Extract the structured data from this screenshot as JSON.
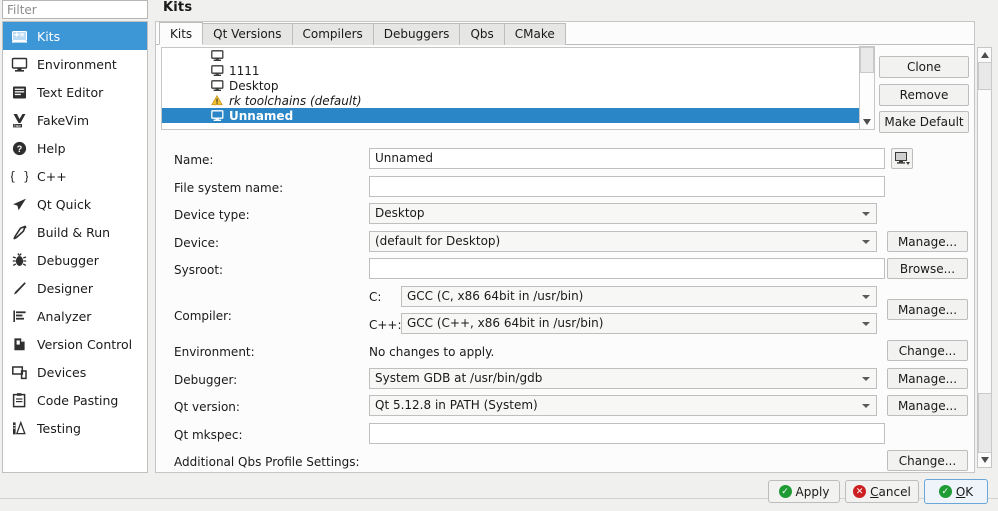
{
  "colors": {
    "accent": "#3d96d6",
    "list_selection": "#2b86c8",
    "apply_green": "#1f9b34",
    "cancel_red": "#cc2020",
    "warning_yellow": "#f2c12e"
  },
  "filter": {
    "placeholder": "Filter",
    "value": ""
  },
  "sidebar": {
    "items": [
      {
        "label": "Kits",
        "icon": "kits-icon",
        "selected": true
      },
      {
        "label": "Environment",
        "icon": "monitor-icon",
        "selected": false
      },
      {
        "label": "Text Editor",
        "icon": "text-editor-icon",
        "selected": false
      },
      {
        "label": "FakeVim",
        "icon": "fakevim-icon",
        "selected": false
      },
      {
        "label": "Help",
        "icon": "help-question-icon",
        "selected": false
      },
      {
        "label": "C++",
        "icon": "braces-icon",
        "selected": false
      },
      {
        "label": "Qt Quick",
        "icon": "paper-plane-icon",
        "selected": false
      },
      {
        "label": "Build & Run",
        "icon": "hammer-icon",
        "selected": false
      },
      {
        "label": "Debugger",
        "icon": "bug-icon",
        "selected": false
      },
      {
        "label": "Designer",
        "icon": "pencil-icon",
        "selected": false
      },
      {
        "label": "Analyzer",
        "icon": "analyzer-chart-icon",
        "selected": false
      },
      {
        "label": "Version Control",
        "icon": "version-control-icon",
        "selected": false
      },
      {
        "label": "Devices",
        "icon": "devices-icon",
        "selected": false
      },
      {
        "label": "Code Pasting",
        "icon": "clipboard-icon",
        "selected": false
      },
      {
        "label": "Testing",
        "icon": "testing-flask-icon",
        "selected": false
      }
    ]
  },
  "header": {
    "title": "Kits"
  },
  "tabs": [
    {
      "label": "Kits",
      "active": true
    },
    {
      "label": "Qt Versions",
      "active": false
    },
    {
      "label": "Compilers",
      "active": false
    },
    {
      "label": "Debuggers",
      "active": false
    },
    {
      "label": "Qbs",
      "active": false
    },
    {
      "label": "CMake",
      "active": false
    }
  ],
  "kit_list": {
    "rows": [
      {
        "label": "",
        "icon": "monitor-icon",
        "selected": false,
        "italic": false
      },
      {
        "label": "1111",
        "icon": "monitor-icon",
        "selected": false,
        "italic": false
      },
      {
        "label": "Desktop",
        "icon": "monitor-icon",
        "selected": false,
        "italic": false
      },
      {
        "label": "rk toolchains (default)",
        "icon": "warning-icon",
        "selected": false,
        "italic": true
      },
      {
        "label": "Unnamed",
        "icon": "monitor-icon",
        "selected": true,
        "italic": false
      }
    ]
  },
  "list_buttons": [
    {
      "label": "Clone"
    },
    {
      "label": "Remove"
    },
    {
      "label": "Make Default"
    }
  ],
  "form": {
    "name": {
      "label": "Name:",
      "value": "Unnamed",
      "button_icon": "monitor-dropdown-icon"
    },
    "file_system_name": {
      "label": "File system name:",
      "value": ""
    },
    "device_type": {
      "label": "Device type:",
      "value": "Desktop"
    },
    "device": {
      "label": "Device:",
      "value": "(default for Desktop)",
      "button": "Manage..."
    },
    "sysroot": {
      "label": "Sysroot:",
      "value": "",
      "button": "Browse..."
    },
    "compiler": {
      "label": "Compiler:",
      "c_label": "C:",
      "c_value": "GCC (C, x86 64bit in /usr/bin)",
      "cpp_label": "C++:",
      "cpp_value": "GCC (C++, x86 64bit in /usr/bin)",
      "button": "Manage..."
    },
    "environment": {
      "label": "Environment:",
      "value": "No changes to apply.",
      "button": "Change..."
    },
    "debugger": {
      "label": "Debugger:",
      "value": "System GDB at /usr/bin/gdb",
      "button": "Manage..."
    },
    "qt_version": {
      "label": "Qt version:",
      "value": "Qt 5.12.8 in PATH (System)",
      "button": "Manage..."
    },
    "qt_mkspec": {
      "label": "Qt mkspec:",
      "value": ""
    },
    "additional_qbs": {
      "label": "Additional Qbs Profile Settings:",
      "button": "Change..."
    }
  },
  "footer": {
    "apply": {
      "label": "Apply",
      "icon": "check-circle-icon"
    },
    "cancel": {
      "label": "Cancel",
      "icon": "x-circle-icon",
      "accel": "C"
    },
    "ok": {
      "label": "OK",
      "icon": "check-circle-icon",
      "accel": "O",
      "default": true
    }
  }
}
